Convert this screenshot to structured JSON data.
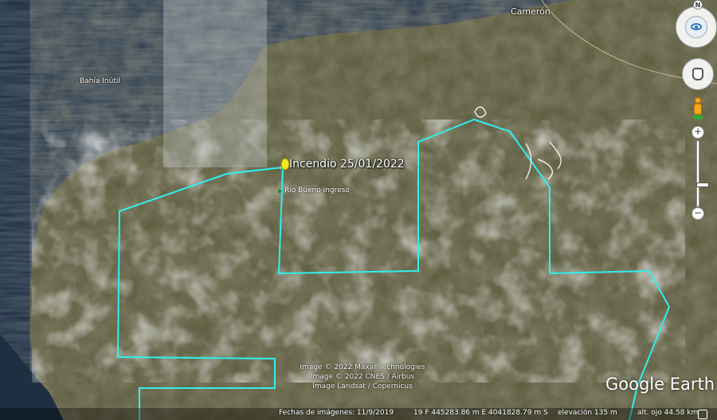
{
  "map": {
    "water_label": "Bahía Inútil",
    "town_label": "Camerón"
  },
  "placemarks": {
    "fire_title": "Incendio 25/01/2022",
    "entry_label": "Río Bueno ingreso"
  },
  "attribution": {
    "line1": "Image © 2022 Maxar Technologies",
    "line2": "Image © 2022 CNES / Airbus",
    "line3": "Image Landsat / Copernicus"
  },
  "logo": "Google Earth",
  "status": {
    "imagery_date": "Fechas de imágenes: 11/9/2019",
    "coordinates": "19 F 445283.86 m E 4041828.79 m S",
    "elevation": "elevación   135 m",
    "eye_alt": "alt. ojo  44.58 km"
  },
  "nav": {
    "north": "N",
    "zoom_in": "+",
    "zoom_out": "−"
  },
  "colors": {
    "boundary": "#2ff0ee",
    "pin": "#f5ea1d"
  }
}
